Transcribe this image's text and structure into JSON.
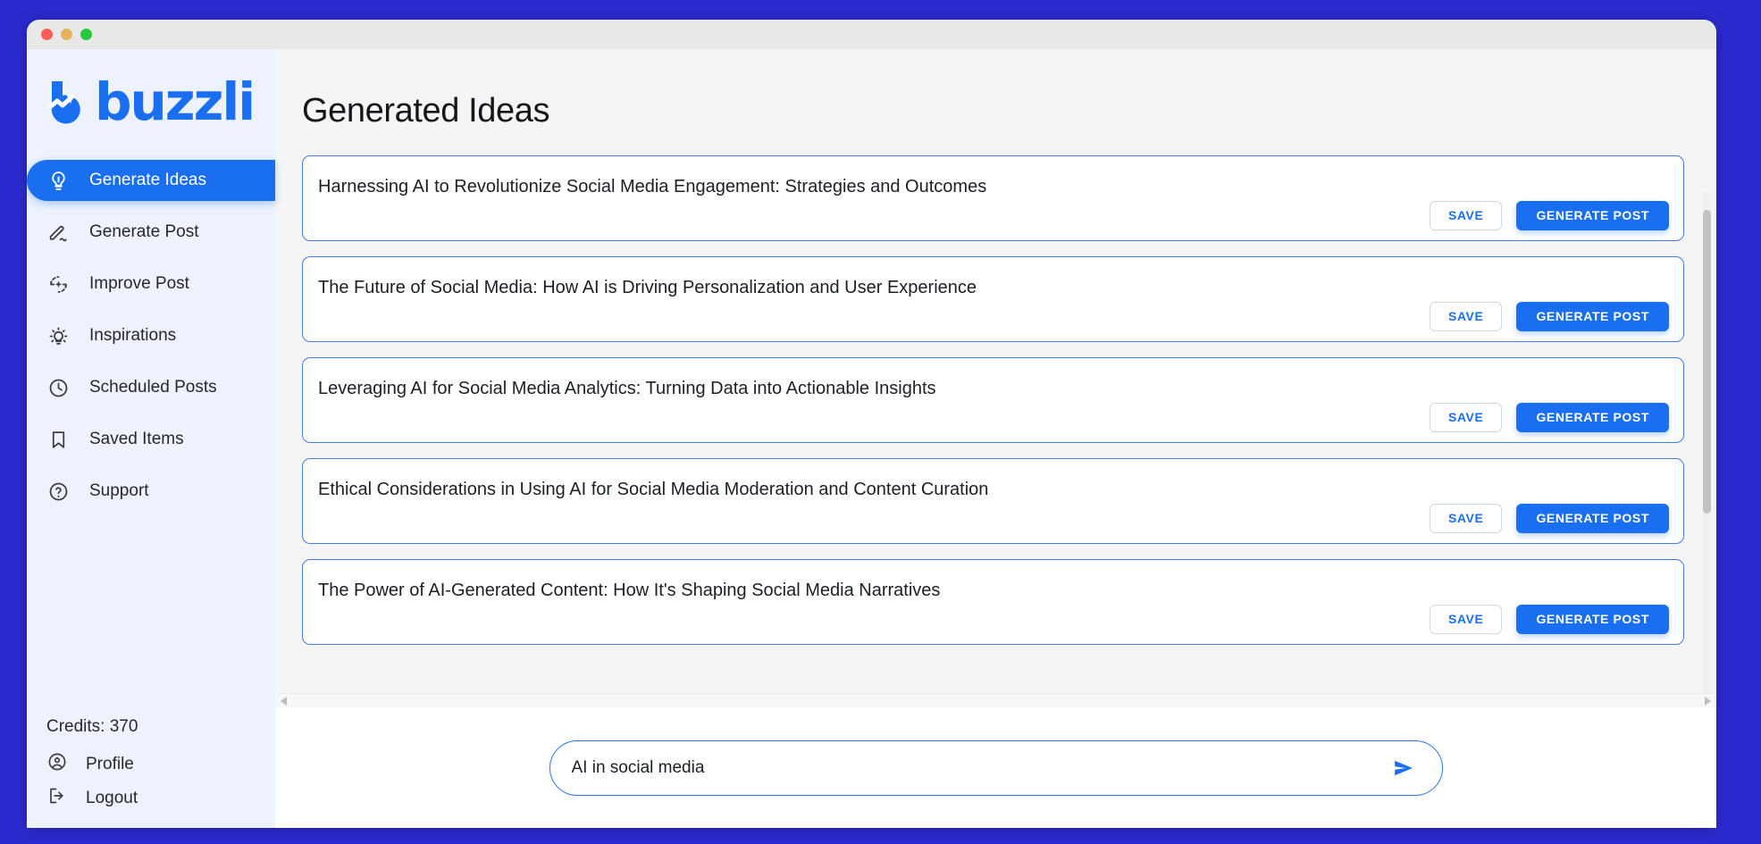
{
  "window": {
    "traffic_lights": [
      "close",
      "minimize",
      "maximize"
    ],
    "background_color": "#2B2ACF"
  },
  "sidebar": {
    "logo_text": "buzzli",
    "logo_color": "#1a6ff0",
    "items": [
      {
        "label": "Generate Ideas",
        "icon": "lightbulb-icon",
        "active": true
      },
      {
        "label": "Generate Post",
        "icon": "pen-squiggle-icon",
        "active": false
      },
      {
        "label": "Improve Post",
        "icon": "refresh-sparkle-icon",
        "active": false
      },
      {
        "label": "Inspirations",
        "icon": "idea-bulb-rays-icon",
        "active": false
      },
      {
        "label": "Scheduled Posts",
        "icon": "clock-icon",
        "active": false
      },
      {
        "label": "Saved Items",
        "icon": "bookmark-icon",
        "active": false
      },
      {
        "label": "Support",
        "icon": "question-circle-icon",
        "active": false
      }
    ],
    "credits_label": "Credits: 370",
    "profile_label": "Profile",
    "logout_label": "Logout"
  },
  "main": {
    "title": "Generated Ideas",
    "save_label": "SAVE",
    "generate_label": "GENERATE POST",
    "accent_color": "#1a6ff0",
    "cards": [
      {
        "title": "Harnessing AI to Revolutionize Social Media Engagement: Strategies and Outcomes"
      },
      {
        "title": "The Future of Social Media: How AI is Driving Personalization and User Experience"
      },
      {
        "title": "Leveraging AI for Social Media Analytics: Turning Data into Actionable Insights"
      },
      {
        "title": "Ethical Considerations in Using AI for Social Media Moderation and Content Curation"
      },
      {
        "title": "The Power of AI-Generated Content: How It's Shaping Social Media Narratives"
      }
    ]
  },
  "prompt": {
    "value": "AI in social media",
    "placeholder": "Type your topic...",
    "send_icon": "send-arrow-icon"
  }
}
